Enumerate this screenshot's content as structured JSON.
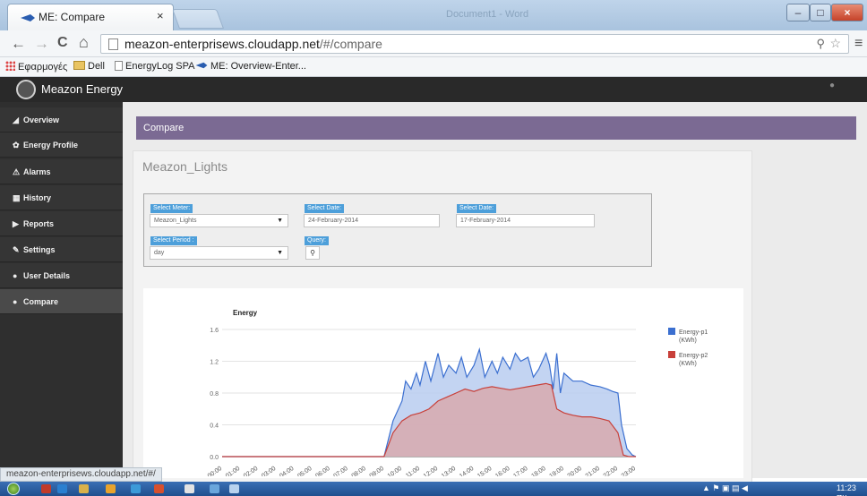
{
  "browser": {
    "tab_title": "ME: Compare",
    "tab_close": "×",
    "ghost_title": "Document1 - Word",
    "window_controls": {
      "minimize": "–",
      "maximize": "□",
      "close": "×"
    },
    "nav": {
      "back": "←",
      "forward": "→",
      "reload": "C",
      "home": "⌂"
    },
    "url_host": "meazon-enterprisews.cloudapp.net",
    "url_path": "/#/compare",
    "zoom_icon": "search-plus-icon",
    "menu_icon": "≡",
    "bookmarks": [
      {
        "label": "Εφαρμογές",
        "icon": "apps"
      },
      {
        "label": "Dell",
        "icon": "folder"
      },
      {
        "label": "EnergyLog SPA",
        "icon": "page"
      },
      {
        "label": "ME: Overview-Enter...",
        "icon": "logo"
      }
    ],
    "status_url": "meazon-enterprisews.cloudapp.net/#/"
  },
  "app": {
    "title": "Meazon Energy",
    "sidebar": [
      {
        "label": "Overview",
        "icon": "◢",
        "active": false
      },
      {
        "label": "Energy Profile",
        "icon": "✿",
        "active": false
      },
      {
        "label": "Alarms",
        "icon": "⚠",
        "active": false
      },
      {
        "label": "History",
        "icon": "▦",
        "active": false
      },
      {
        "label": "Reports",
        "icon": "▶",
        "active": false
      },
      {
        "label": "Settings",
        "icon": "✎",
        "active": false
      },
      {
        "label": "User Details",
        "icon": "●",
        "active": false
      },
      {
        "label": "Compare",
        "icon": "●",
        "active": true
      }
    ],
    "section_header": "Compare",
    "panel_title": "Meazon_Lights",
    "form": {
      "meter_label": "Select Meter:",
      "meter_value": "Meazon_Lights",
      "date1_label": "Select Date:",
      "date1_value": "24-February-2014",
      "date2_label": "Select Date:",
      "date2_value": "17-February-2014",
      "period_label": "Select Period :",
      "period_value": "day",
      "query_label": "Query:",
      "caret": "▼",
      "query_icon": "search-icon"
    }
  },
  "chart_data": {
    "type": "area",
    "title": "Energy",
    "ylim": [
      0,
      1.6
    ],
    "yticks": [
      "0.0",
      "0.4",
      "0.8",
      "1.2",
      "1.6"
    ],
    "categories": [
      "00:00",
      "01:00",
      "02:00",
      "03:00",
      "04:00",
      "05:00",
      "06:00",
      "07:00",
      "08:00",
      "09:00",
      "10:00",
      "11:00",
      "12:00",
      "13:00",
      "14:00",
      "15:00",
      "16:00",
      "17:00",
      "18:00",
      "19:00",
      "20:00",
      "21:00",
      "22:00",
      "23:00"
    ],
    "legend_position": "right",
    "series": [
      {
        "name": "Energy-p1",
        "unit": "(KWh)",
        "color": "#3b6fd0",
        "fill": "#b9cdf0",
        "x": [
          0,
          1,
          2,
          3,
          4,
          5,
          6,
          7,
          8,
          9,
          9.5,
          10,
          10.2,
          10.5,
          10.8,
          11,
          11.3,
          11.6,
          12,
          12.3,
          12.6,
          13,
          13.3,
          13.6,
          14,
          14.3,
          14.6,
          15,
          15.3,
          15.6,
          16,
          16.3,
          16.6,
          17,
          17.3,
          17.6,
          18,
          18.2,
          18.4,
          18.6,
          18.8,
          19,
          19.5,
          20,
          20.5,
          21,
          21.4,
          21.7,
          22,
          22.2,
          22.5,
          22.8,
          23
        ],
        "values": [
          0,
          0,
          0,
          0,
          0,
          0,
          0,
          0,
          0,
          0,
          0.45,
          0.7,
          0.95,
          0.85,
          1.05,
          0.9,
          1.2,
          0.95,
          1.3,
          1.0,
          1.15,
          1.05,
          1.25,
          1.0,
          1.15,
          1.35,
          1.0,
          1.2,
          1.05,
          1.25,
          1.1,
          1.3,
          1.2,
          1.25,
          1.0,
          1.1,
          1.3,
          1.15,
          0.85,
          1.3,
          0.8,
          1.05,
          0.95,
          0.95,
          0.9,
          0.88,
          0.85,
          0.82,
          0.8,
          0.4,
          0.1,
          0.02,
          0
        ]
      },
      {
        "name": "Energy-p2",
        "unit": "(KWh)",
        "color": "#c8403a",
        "fill": "#d8a9ae",
        "x": [
          0,
          1,
          2,
          3,
          4,
          5,
          6,
          7,
          8,
          9,
          9.5,
          10,
          10.5,
          11,
          11.5,
          12,
          12.5,
          13,
          13.5,
          14,
          14.5,
          15,
          15.5,
          16,
          16.5,
          17,
          17.5,
          18,
          18.3,
          18.6,
          19,
          19.5,
          20,
          20.5,
          21,
          21.5,
          22,
          22.3,
          22.6,
          23
        ],
        "values": [
          0,
          0,
          0,
          0,
          0,
          0,
          0,
          0,
          0,
          0,
          0.3,
          0.45,
          0.52,
          0.55,
          0.6,
          0.7,
          0.75,
          0.8,
          0.85,
          0.82,
          0.86,
          0.88,
          0.86,
          0.84,
          0.86,
          0.88,
          0.9,
          0.92,
          0.9,
          0.6,
          0.55,
          0.52,
          0.5,
          0.5,
          0.48,
          0.45,
          0.3,
          0.02,
          0,
          0
        ]
      }
    ]
  }
}
